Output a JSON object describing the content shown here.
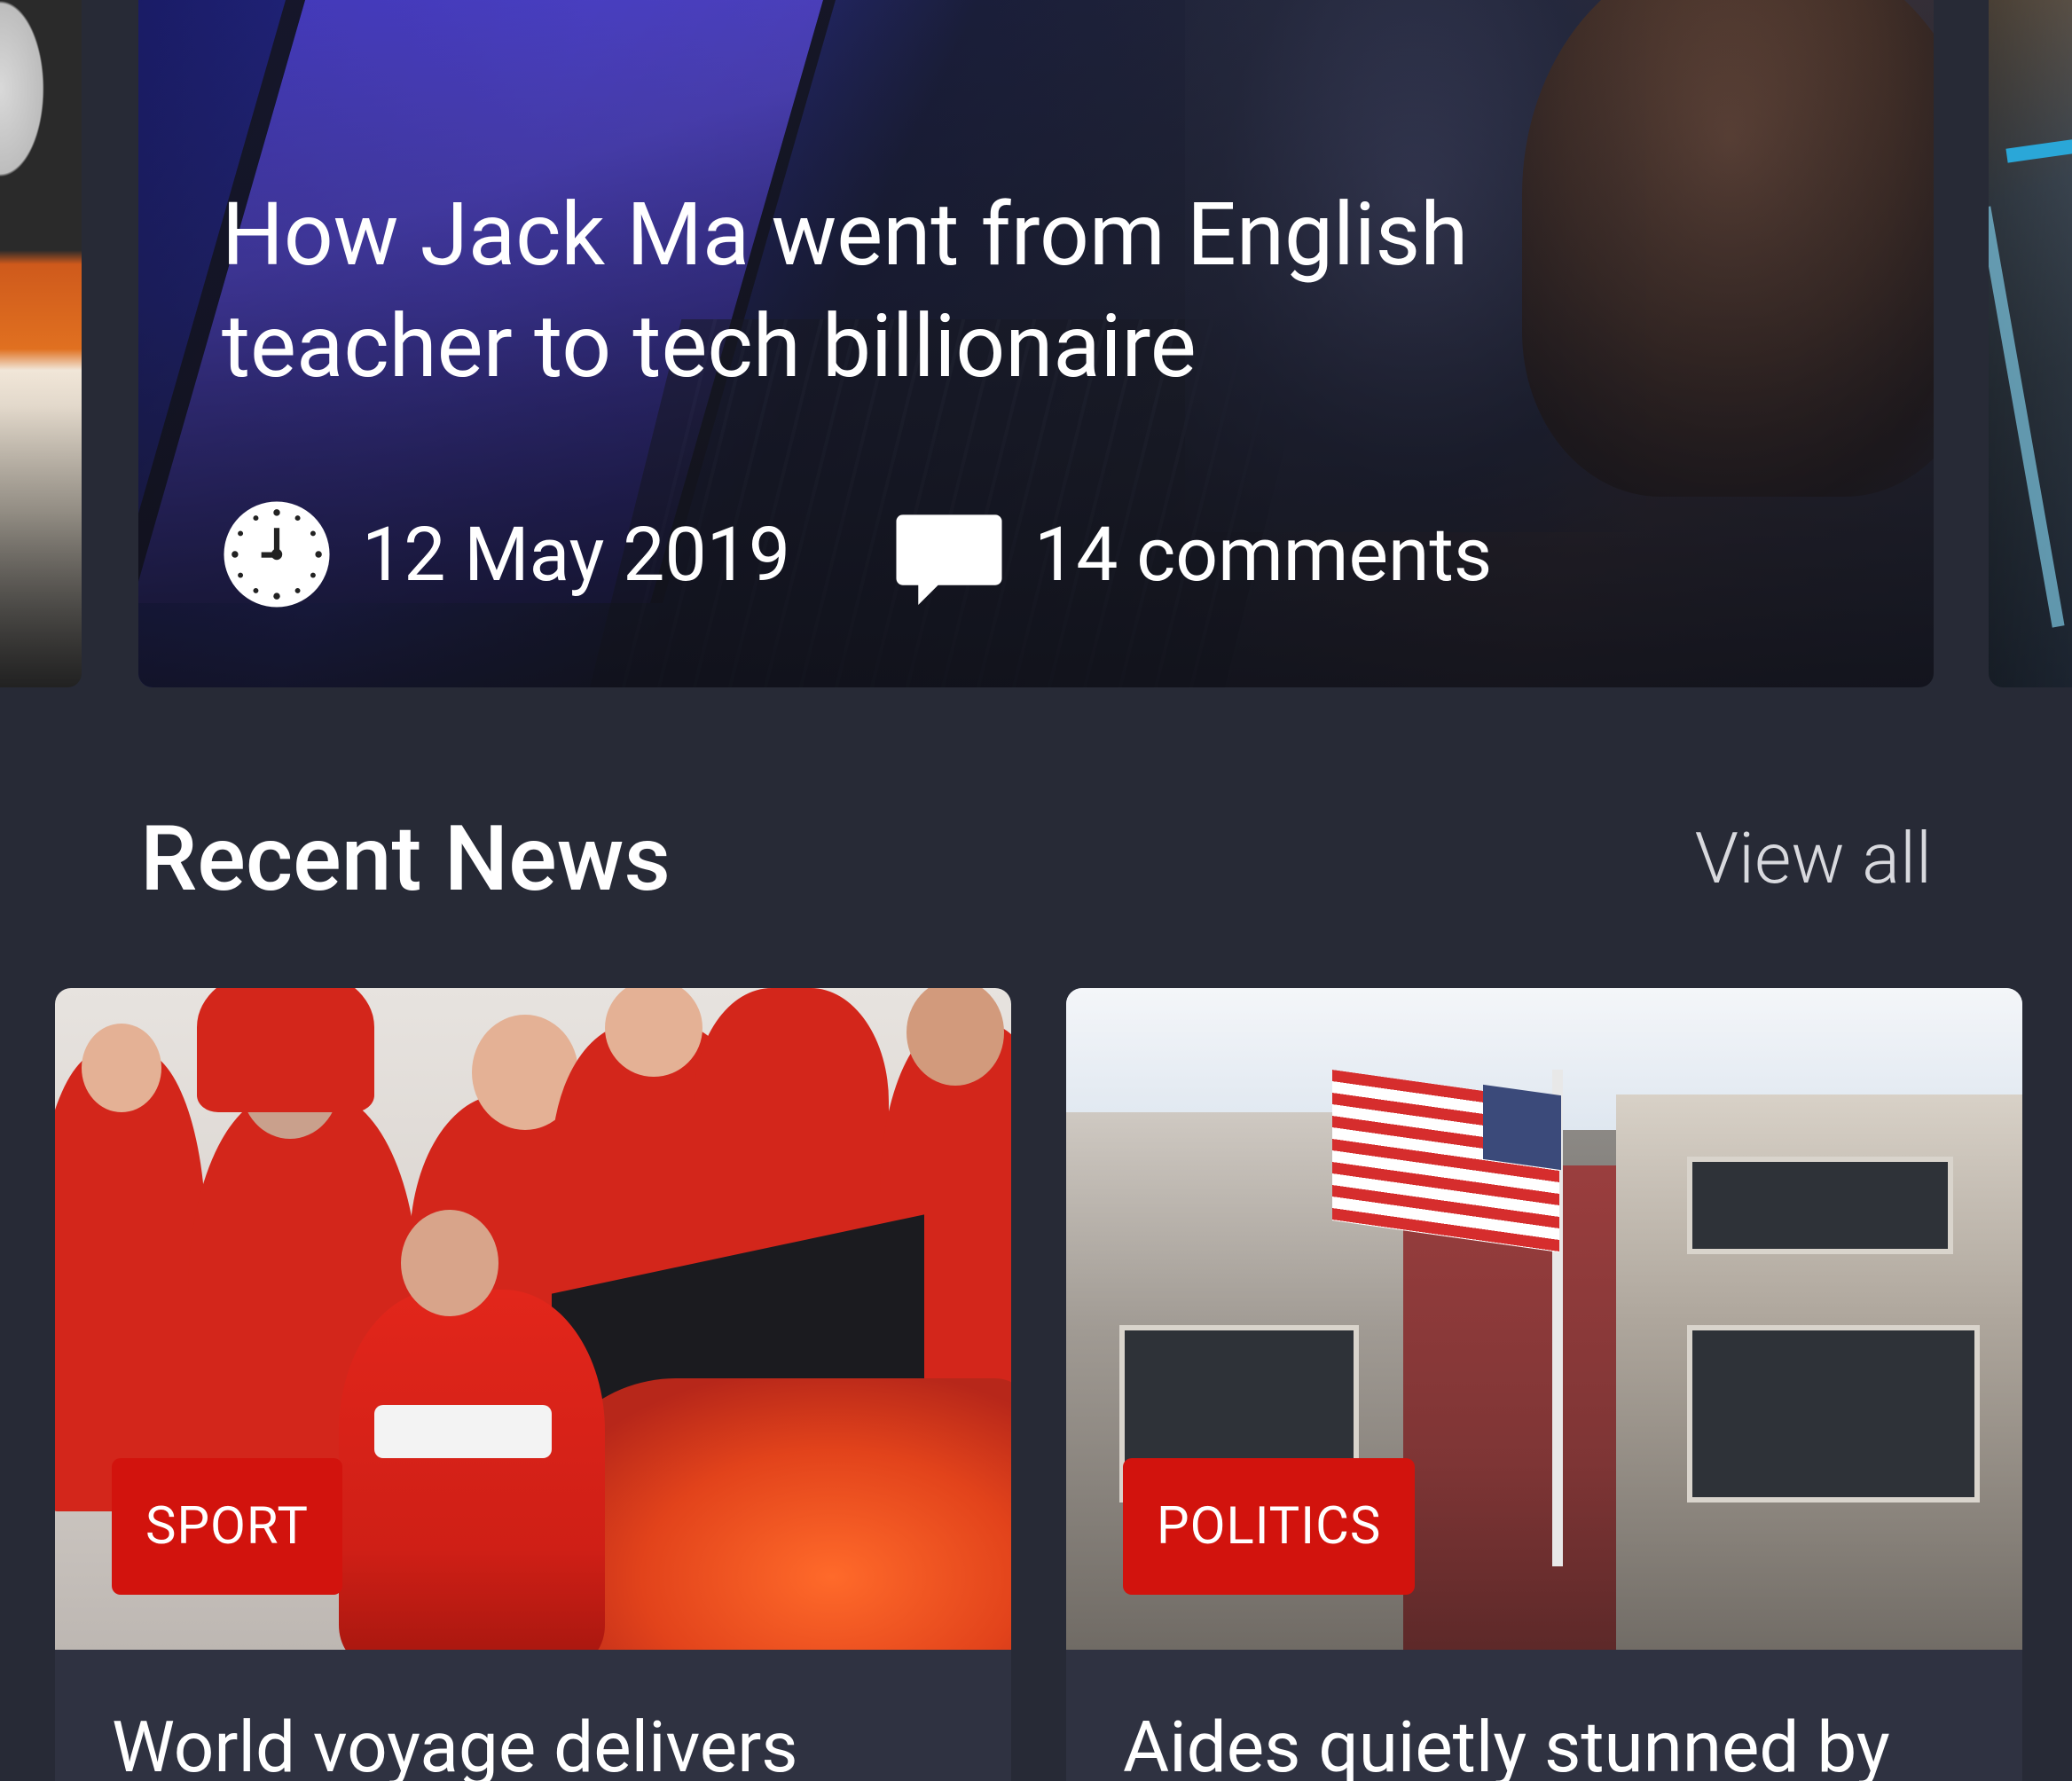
{
  "featured": {
    "title_line1": "How Jack Ma went from English",
    "title_line2": "teacher to tech billionaire",
    "date": "12 May 2019",
    "comments": "14 comments",
    "date_icon": "clock-icon",
    "comments_icon": "comment-icon"
  },
  "section": {
    "title": "Recent News",
    "view_all": "View all"
  },
  "cards": [
    {
      "category": "SPORT",
      "title": "World voyage delivers",
      "category_color": "#d2130d"
    },
    {
      "category": "POLITICS",
      "title": "Aides quietly stunned by",
      "category_color": "#d2130d"
    }
  ],
  "colors": {
    "background": "#272a36",
    "card": "#2f3241",
    "accent": "#d2130d",
    "text": "#ffffff"
  }
}
